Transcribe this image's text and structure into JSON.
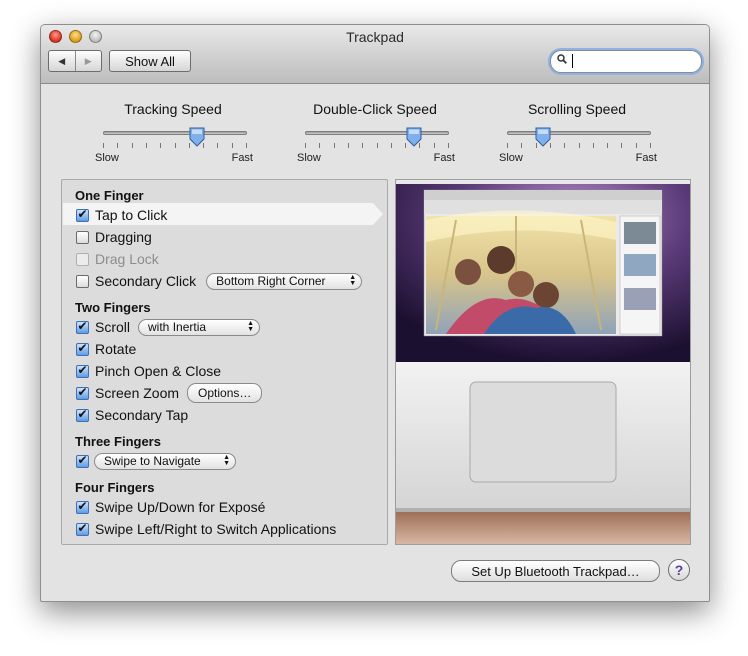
{
  "window": {
    "title": "Trackpad",
    "nav_back_label": "◀",
    "nav_forward_label": "▶",
    "show_all_label": "Show All",
    "search": {
      "value": "",
      "placeholder": ""
    }
  },
  "sliders": [
    {
      "label": "Tracking Speed",
      "min_label": "Slow",
      "max_label": "Fast",
      "value": 0.65
    },
    {
      "label": "Double-Click Speed",
      "min_label": "Slow",
      "max_label": "Fast",
      "value": 0.76
    },
    {
      "label": "Scrolling Speed",
      "min_label": "Slow",
      "max_label": "Fast",
      "value": 0.25
    }
  ],
  "options": {
    "one_finger": {
      "title": "One Finger",
      "tap_to_click": {
        "label": "Tap to Click",
        "checked": true
      },
      "dragging": {
        "label": "Dragging",
        "checked": false
      },
      "drag_lock": {
        "label": "Drag Lock",
        "checked": false,
        "enabled": false
      },
      "secondary_click": {
        "label": "Secondary Click",
        "checked": false,
        "popup": "Bottom Right Corner"
      }
    },
    "two_fingers": {
      "title": "Two Fingers",
      "scroll": {
        "label": "Scroll",
        "checked": true,
        "popup": "with Inertia"
      },
      "rotate": {
        "label": "Rotate",
        "checked": true
      },
      "pinch": {
        "label": "Pinch Open & Close",
        "checked": true
      },
      "screen_zoom": {
        "label": "Screen Zoom",
        "checked": true,
        "button": "Options…"
      },
      "secondary_tap": {
        "label": "Secondary Tap",
        "checked": true
      }
    },
    "three_fingers": {
      "title": "Three Fingers",
      "swipe": {
        "checked": true,
        "popup": "Swipe to Navigate"
      }
    },
    "four_fingers": {
      "title": "Four Fingers",
      "expose": {
        "label": "Swipe Up/Down for Exposé",
        "checked": true
      },
      "switch_apps": {
        "label": "Swipe Left/Right to Switch Applications",
        "checked": true
      }
    }
  },
  "footer": {
    "setup_label": "Set Up Bluetooth Trackpad…",
    "help_label": "?"
  },
  "colors": {
    "checkbox_accent": "#5e9be5",
    "search_focus": "#8db2e3",
    "help_glyph": "#5b3f9a"
  }
}
